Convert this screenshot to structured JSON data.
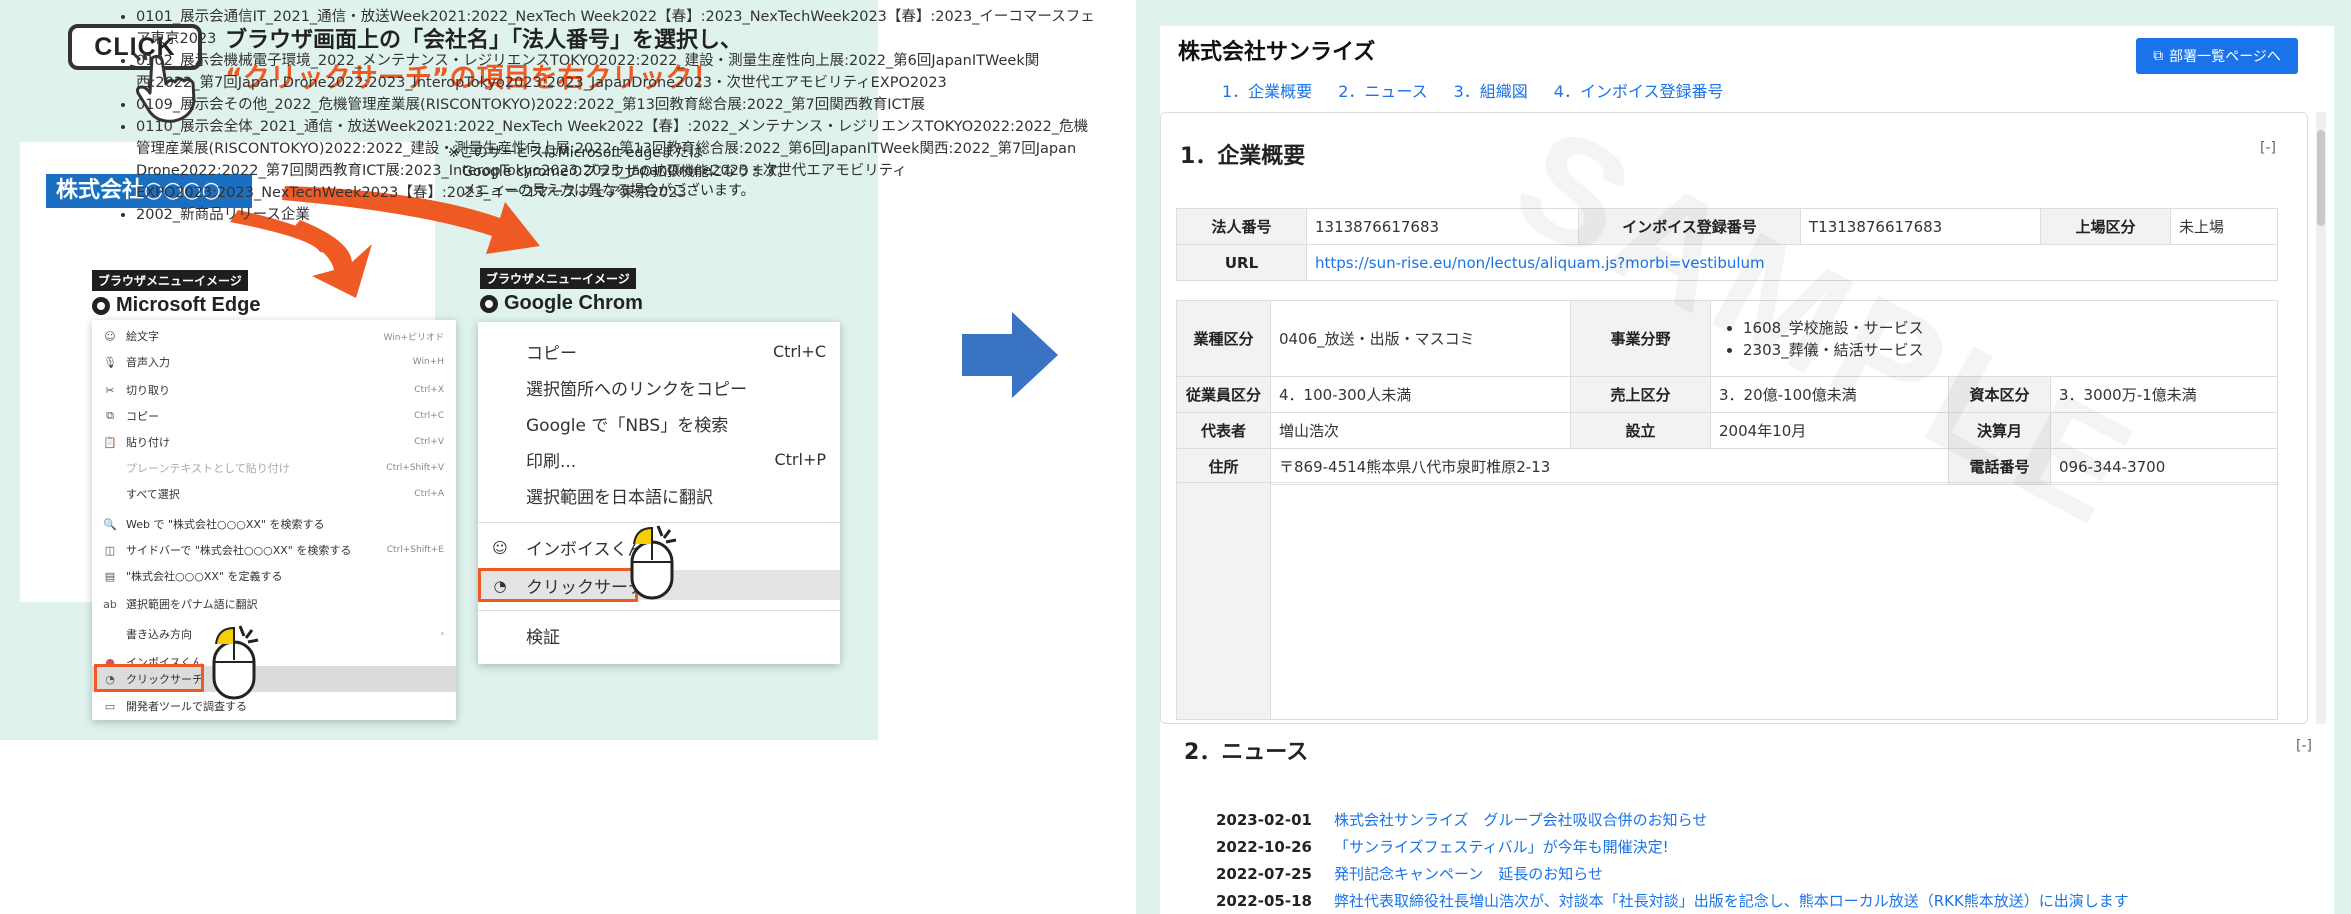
{
  "instructions": {
    "click_label": "CLICK",
    "heading_line1": "ブラウザ画面上の「会社名」「法人番号」を選択し、",
    "heading_line2": "“クリックサーチ”の項目を右クリック！",
    "sample_company": "株式会社○○○○",
    "note_lines": [
      "※このサービスはMicrosoft edgeまたは",
      "　Google chromeのブラウザの拡張機能になります。",
      "　メニューの見え方は異なる場合がございます。"
    ]
  },
  "edge": {
    "tag": "ブラウザメニューイメージ",
    "browser_name": "Microsoft Edge",
    "items": [
      {
        "icon": "☺",
        "label": "絵文字",
        "shortcut": "Win+ピリオド"
      },
      {
        "icon": "🎙",
        "label": "音声入力",
        "shortcut": "Win+H"
      },
      {
        "icon": "✂",
        "label": "切り取り",
        "shortcut": "Ctrl+X"
      },
      {
        "icon": "⧉",
        "label": "コピー",
        "shortcut": "Ctrl+C"
      },
      {
        "icon": "📋",
        "label": "貼り付け",
        "shortcut": "Ctrl+V"
      },
      {
        "icon": "",
        "label": "プレーンテキストとして貼り付け",
        "shortcut": "Ctrl+Shift+V"
      },
      {
        "icon": "",
        "label": "すべて選択",
        "shortcut": "Ctrl+A"
      },
      {
        "icon": "🔍",
        "label": "Web で \"株式会社○○○XX\" を検索する",
        "shortcut": ""
      },
      {
        "icon": "◫",
        "label": "サイドバーで \"株式会社○○○XX\" を検索する",
        "shortcut": "Ctrl+Shift+E"
      },
      {
        "icon": "▤",
        "label": "\"株式会社○○○XX\" を定義する",
        "shortcut": ""
      },
      {
        "icon": "ab",
        "label": "選択範囲をパナム語に翻訳",
        "shortcut": ""
      },
      {
        "icon": "",
        "label": "書き込み方向",
        "shortcut": "›"
      },
      {
        "icon": "●",
        "label": "インボイスくん",
        "shortcut": ""
      },
      {
        "icon": "◔",
        "label": "クリックサーチ",
        "shortcut": ""
      },
      {
        "icon": "▭",
        "label": "開発者ツールで調査する",
        "shortcut": ""
      }
    ]
  },
  "chrome": {
    "tag": "ブラウザメニューイメージ",
    "browser_name": "Google Chrom",
    "items": [
      {
        "label": "コピー",
        "shortcut": "Ctrl+C"
      },
      {
        "label": "選択箇所へのリンクをコピー",
        "shortcut": ""
      },
      {
        "label": "Google で「NBS」を検索",
        "shortcut": ""
      },
      {
        "label": "印刷...",
        "shortcut": "Ctrl+P"
      },
      {
        "label": "選択範囲を日本語に翻訳",
        "shortcut": ""
      },
      {
        "label": "インボイスくん",
        "shortcut": ""
      },
      {
        "label": "クリックサーチ",
        "shortcut": ""
      },
      {
        "label": "検証",
        "shortcut": ""
      }
    ]
  },
  "company_page": {
    "title": "株式会社サンライズ",
    "dept_button": "部署一覧ページへ",
    "nav": [
      "1．企業概要",
      "2．ニュース",
      "3．組織図",
      "4．インボイス登録番号"
    ],
    "section1_title": "1．企業概要",
    "section2_title": "2．ニュース",
    "collapse_label": "[-]",
    "watermark": "SAMPLE",
    "basic": {
      "corp_no_label": "法人番号",
      "corp_no": "1313876617683",
      "invoice_label": "インボイス登録番号",
      "invoice": "T1313876617683",
      "listing_label": "上場区分",
      "listing": "未上場",
      "url_label": "URL",
      "url": "https://sun-rise.eu/non/lectus/aliquam.js?morbi=vestibulum"
    },
    "detail": {
      "industry_label": "業種区分",
      "industry": "0406_放送・出版・マスコミ",
      "field_label": "事業分野",
      "fields": [
        "1608_学校施設・サービス",
        "2303_葬儀・結活サービス"
      ],
      "employees_label": "従業員区分",
      "employees": "4．100-300人未満",
      "sales_label": "売上区分",
      "sales": "3．20億-100億未満",
      "capital_label": "資本区分",
      "capital": "3．3000万-1億未満",
      "rep_label": "代表者",
      "rep": "増山浩次",
      "founded_label": "設立",
      "founded": "2004年10月",
      "fiscal_label": "決算月",
      "fiscal": "",
      "address_label": "住所",
      "address": "〒869-4514熊本県八代市泉町椎原2-13",
      "phone_label": "電話番号",
      "phone": "096-344-3700"
    },
    "expos": [
      "0101_展示会通信IT_2021_通信・放送Week2021:2022_NexTech Week2022【春】:2023_NexTechWeek2023【春】:2023_イーコマースフェア東京2023",
      "0102_展示会機械電子環境_2022_メンテナンス・レジリエンスTOKYO2022:2022_建設・測量生産性向上展:2022_第6回JapanITWeek関西:2022_第7回Japan Drone2022:2023_InteropTokyo2023:2023_JapanDrone2023・次世代エアモビリティEXPO2023",
      "0109_展示会その他_2022_危機管理産業展(RISCONTOKYO)2022:2022_第13回教育総合展:2022_第7回関西教育ICT展",
      "0110_展示会全体_2021_通信・放送Week2021:2022_NexTech Week2022【春】:2022_メンテナンス・レジリエンスTOKYO2022:2022_危機管理産業展(RISCONTOKYO)2022:2022_建設・測量生産性向上展:2022_第13回教育総合展:2022_第6回JapanITWeek関西:2022_第7回Japan Drone2022:2022_第7回関西教育ICT展:2023_InteropTokyo2023:2023_JapanDrone2023・次世代エアモビリティEXPO2023:2023_NexTechWeek2023【春】:2023_イーコマースフェア東京2023",
      "2002_新商品リリース企業"
    ],
    "news": [
      {
        "date": "2023-02-01",
        "title": "株式会社サンライズ　グループ会社吸収合併のお知らせ"
      },
      {
        "date": "2022-10-26",
        "title": "「サンライズフェスティバル」が今年も開催決定!"
      },
      {
        "date": "2022-07-25",
        "title": "発刊記念キャンペーン　延長のお知らせ"
      },
      {
        "date": "2022-05-18",
        "title": "弊社代表取締役社長増山浩次が、対談本「社長対談」出版を記念し、熊本ローカル放送（RKK熊本放送）に出演します"
      }
    ]
  },
  "colors": {
    "accent_orange": "#ef5a24",
    "link_blue": "#1a73e8",
    "panel_bg": "#dff2ee",
    "company_blue": "#1b6fc0"
  }
}
